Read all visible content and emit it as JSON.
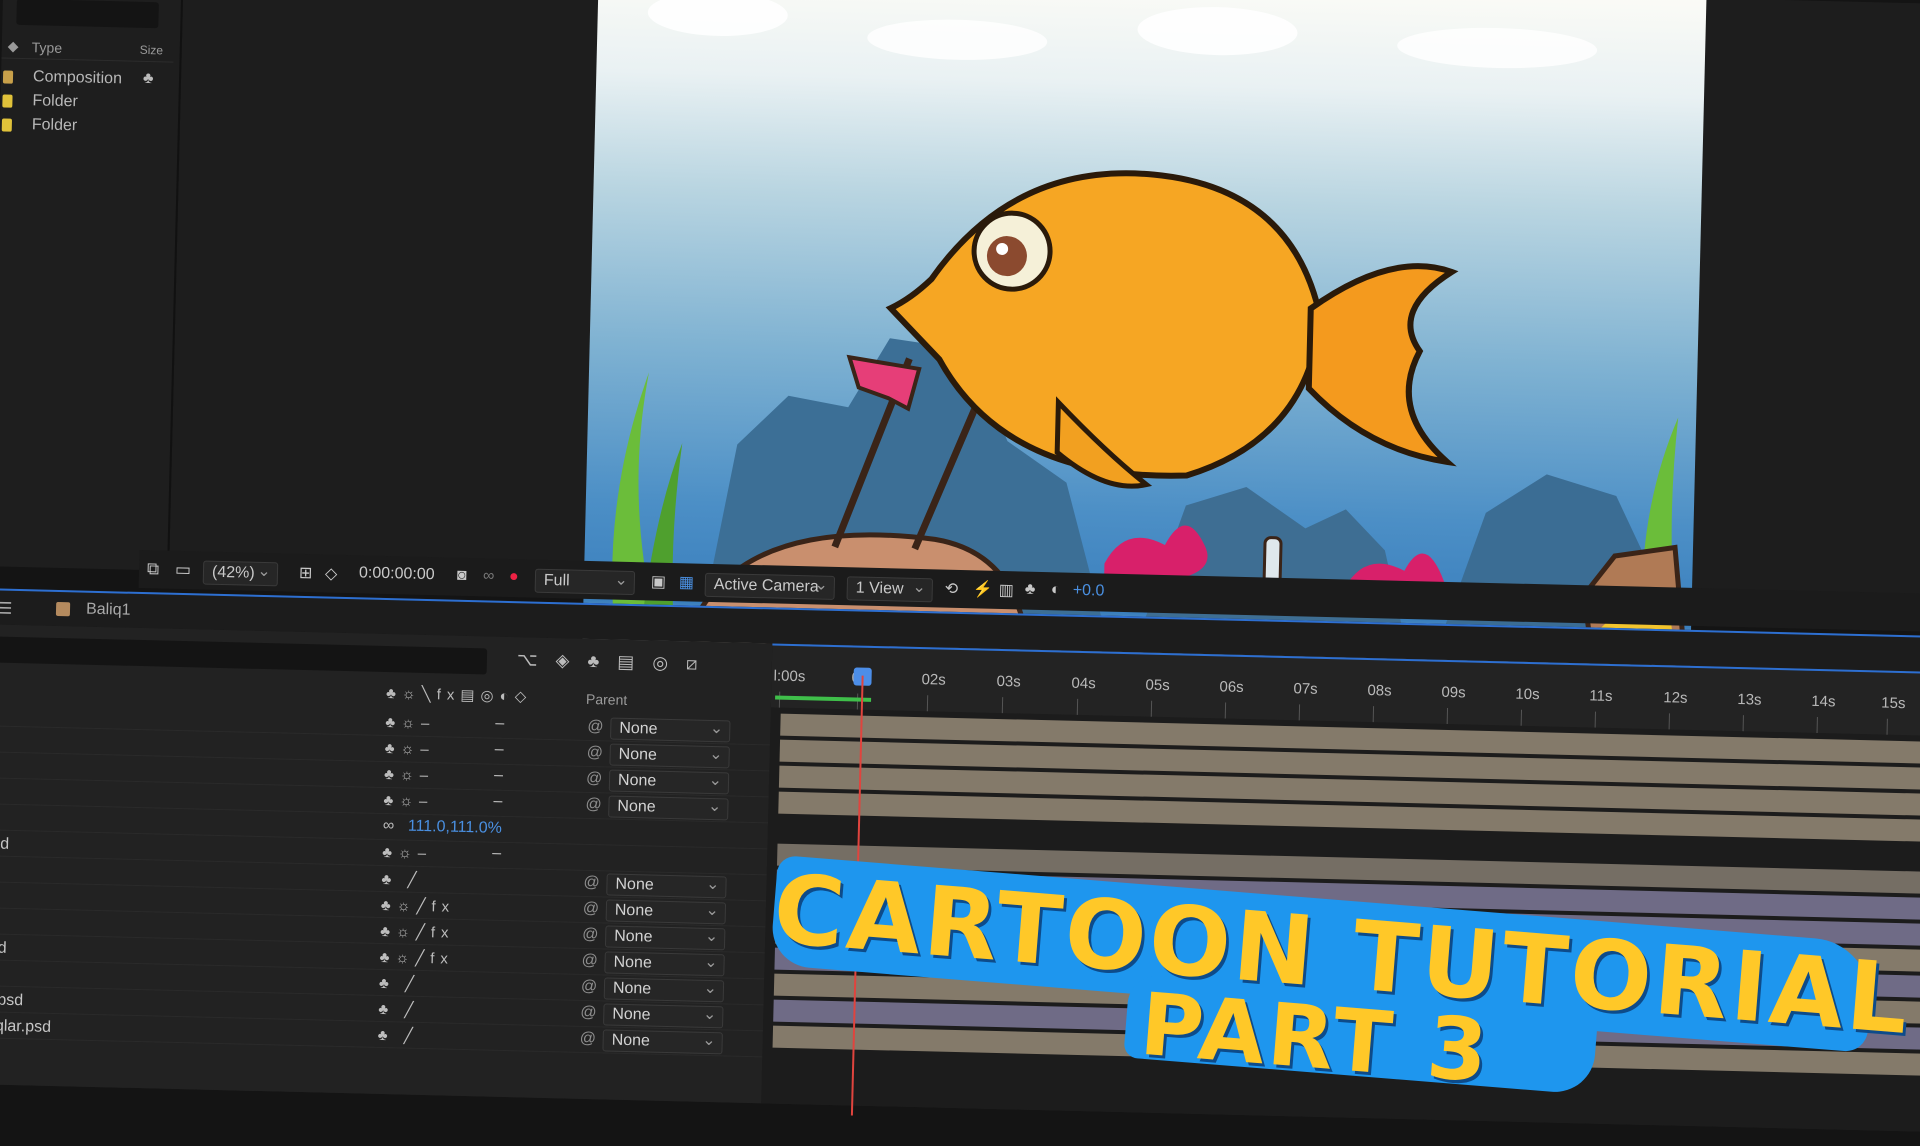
{
  "project": {
    "columns": {
      "type": "Type",
      "size": "Size"
    },
    "items": [
      {
        "label": "Composition",
        "color": "#c8a04a"
      },
      {
        "label": "Folder",
        "color": "#e0c23a"
      },
      {
        "label": "Folder",
        "color": "#e0c23a"
      }
    ]
  },
  "viewer": {
    "zoom": "(42%)",
    "timecode": "0:00:00:00",
    "resolution": "Full",
    "camera": "Active Camera",
    "views": "1 View",
    "exposure": "+0.0"
  },
  "composition": {
    "tab": "Baliq1"
  },
  "timeline": {
    "parent_header": "Parent",
    "scale_value": "111.0,111.0%",
    "rows": [
      {
        "name": "",
        "parent": "None",
        "fx": false
      },
      {
        "name": "",
        "parent": "None",
        "fx": false
      },
      {
        "name": "",
        "parent": "None",
        "fx": false
      },
      {
        "name": "",
        "parent": "None",
        "fx": false
      },
      {
        "name": "sd",
        "parent": "",
        "fx": false
      },
      {
        "name": "",
        "parent": "None",
        "fx": false
      },
      {
        "name": "",
        "parent": "None",
        "fx": true
      },
      {
        "name": "",
        "parent": "None",
        "fx": true
      },
      {
        "name": "sd",
        "parent": "None",
        "fx": true
      },
      {
        "name": "d",
        "parent": "None",
        "fx": false
      },
      {
        "name": "r.psd",
        "parent": "None",
        "fx": false
      },
      {
        "name": "liqlar.psd",
        "parent": "None",
        "fx": false
      }
    ],
    "ticks": [
      "l:00s",
      "0",
      "02s",
      "03s",
      "04s",
      "05s",
      "06s",
      "07s",
      "08s",
      "09s",
      "10s",
      "11s",
      "12s",
      "13s",
      "14s",
      "15s"
    ]
  },
  "headline": {
    "line1": "CARTOON TUTORIAL",
    "line2": "PART 3"
  },
  "colors": {
    "accent": "#2d6fd1",
    "headline": "#ffc828",
    "brush": "#1e96ee"
  }
}
